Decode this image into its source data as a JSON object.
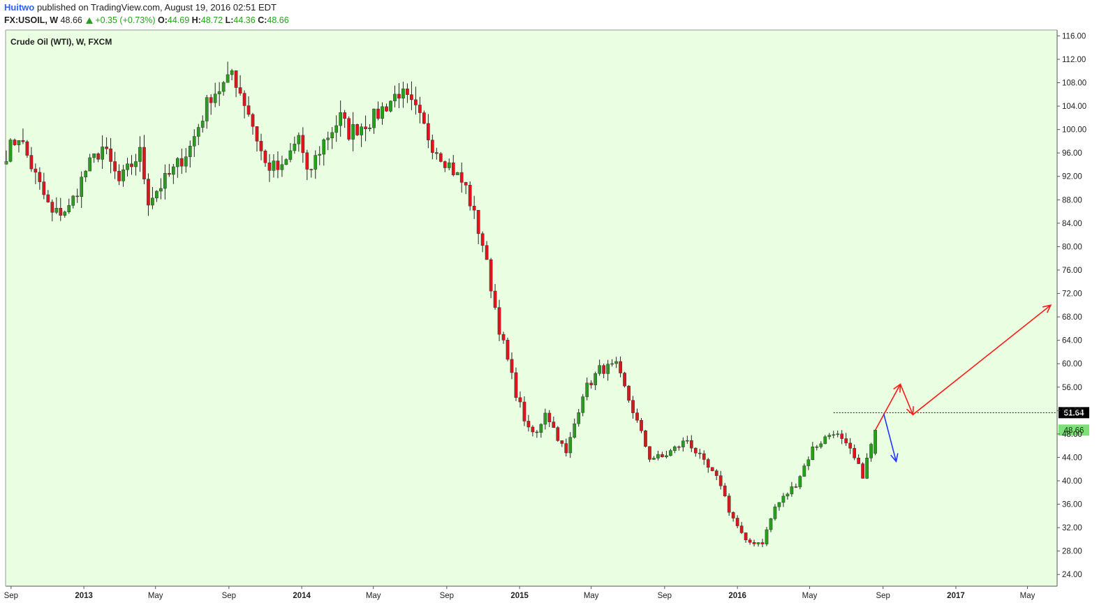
{
  "header": {
    "author": "Huitwo",
    "published": "published on TradingView.com, August 19, 2016 02:51 EDT",
    "symbol": "FX:USOIL, W",
    "last": "48.66",
    "change": "+0.35 (+0.73%)",
    "o_label": "O:",
    "o_value": "44.69",
    "h_label": "H:",
    "h_value": "48.72",
    "l_label": "L:",
    "l_value": "44.36",
    "c_label": "C:",
    "c_value": "48.66"
  },
  "colors": {
    "background": "#eaffe1",
    "up": "#26a01b",
    "down": "#e4121b",
    "arrow_red": "#ff1a1a",
    "arrow_blue": "#2233ff",
    "level_label_bg": "#000000",
    "price_label_bg": "#7fe07a"
  },
  "chart_data": {
    "type": "candlestick",
    "title": "Crude Oil (WTI), W, FXCM",
    "ylim": [
      22,
      117
    ],
    "y_ticks": [
      "24.00",
      "28.00",
      "32.00",
      "36.00",
      "40.00",
      "44.00",
      "48.00",
      "52.00",
      "56.00",
      "60.00",
      "64.00",
      "68.00",
      "72.00",
      "76.00",
      "80.00",
      "84.00",
      "88.00",
      "92.00",
      "96.00",
      "100.00",
      "104.00",
      "108.00",
      "112.00",
      "116.00"
    ],
    "x_labels": [
      {
        "label": "Sep",
        "date": "2012-09-01"
      },
      {
        "label": "2013",
        "date": "2013-01-01"
      },
      {
        "label": "May",
        "date": "2013-05-01"
      },
      {
        "label": "Sep",
        "date": "2013-09-01"
      },
      {
        "label": "2014",
        "date": "2014-01-01"
      },
      {
        "label": "May",
        "date": "2014-05-01"
      },
      {
        "label": "Sep",
        "date": "2014-09-01"
      },
      {
        "label": "2015",
        "date": "2015-01-01"
      },
      {
        "label": "May",
        "date": "2015-05-01"
      },
      {
        "label": "Sep",
        "date": "2015-09-01"
      },
      {
        "label": "2016",
        "date": "2016-01-01"
      },
      {
        "label": "May",
        "date": "2016-05-01"
      },
      {
        "label": "Sep",
        "date": "2016-09-01"
      },
      {
        "label": "2017",
        "date": "2017-01-01"
      },
      {
        "label": "May",
        "date": "2017-05-01"
      }
    ],
    "price_path": [
      [
        "2012-08-24",
        96.0
      ],
      [
        "2012-09-14",
        99.0
      ],
      [
        "2012-10-12",
        92.0
      ],
      [
        "2012-11-09",
        85.5
      ],
      [
        "2012-12-07",
        86.5
      ],
      [
        "2013-01-04",
        93.0
      ],
      [
        "2013-02-01",
        97.0
      ],
      [
        "2013-03-01",
        91.0
      ],
      [
        "2013-04-05",
        96.0
      ],
      [
        "2013-04-19",
        88.0
      ],
      [
        "2013-05-31",
        93.0
      ],
      [
        "2013-06-28",
        97.0
      ],
      [
        "2013-08-02",
        106.0
      ],
      [
        "2013-08-30",
        108.0
      ],
      [
        "2013-09-06",
        110.0
      ],
      [
        "2013-10-04",
        103.0
      ],
      [
        "2013-11-01",
        94.0
      ],
      [
        "2013-11-29",
        93.0
      ],
      [
        "2013-12-27",
        99.0
      ],
      [
        "2014-01-10",
        92.0
      ],
      [
        "2014-02-07",
        98.0
      ],
      [
        "2014-03-07",
        102.0
      ],
      [
        "2014-03-21",
        99.5
      ],
      [
        "2014-05-02",
        102.0
      ],
      [
        "2014-06-13",
        106.5
      ],
      [
        "2014-07-11",
        103.0
      ],
      [
        "2014-08-08",
        97.5
      ],
      [
        "2014-09-05",
        94.0
      ],
      [
        "2014-10-03",
        90.0
      ],
      [
        "2014-10-31",
        80.5
      ],
      [
        "2014-11-28",
        66.0
      ],
      [
        "2014-12-26",
        55.0
      ],
      [
        "2015-01-16",
        48.5
      ],
      [
        "2015-01-30",
        48.0
      ],
      [
        "2015-02-13",
        52.0
      ],
      [
        "2015-03-13",
        46.0
      ],
      [
        "2015-03-20",
        44.5
      ],
      [
        "2015-04-17",
        55.0
      ],
      [
        "2015-05-15",
        59.0
      ],
      [
        "2015-06-12",
        59.5
      ],
      [
        "2015-07-10",
        52.0
      ],
      [
        "2015-08-07",
        44.0
      ],
      [
        "2015-08-28",
        44.0
      ],
      [
        "2015-09-11",
        45.0
      ],
      [
        "2015-10-09",
        47.0
      ],
      [
        "2015-11-06",
        43.0
      ],
      [
        "2015-12-04",
        39.5
      ],
      [
        "2015-12-18",
        35.0
      ],
      [
        "2016-01-15",
        29.5
      ],
      [
        "2016-02-12",
        29.5
      ],
      [
        "2016-03-04",
        35.5
      ],
      [
        "2016-04-08",
        39.5
      ],
      [
        "2016-05-06",
        45.5
      ],
      [
        "2016-06-10",
        48.5
      ],
      [
        "2016-07-08",
        45.0
      ],
      [
        "2016-07-29",
        41.0
      ],
      [
        "2016-08-19",
        48.66
      ]
    ],
    "last_candle": {
      "date": "2016-08-19",
      "open": 44.69,
      "high": 48.72,
      "low": 44.36,
      "close": 48.66
    },
    "current_price": 48.66,
    "horizontal_level": 51.64,
    "annotations": [
      {
        "type": "path-arrow",
        "color": "red",
        "points": [
          [
            "2016-08-19",
            48.66
          ],
          [
            "2016-09-30",
            56.5
          ],
          [
            "2016-10-21",
            51.3
          ],
          [
            "2017-06-09",
            70.0
          ]
        ]
      },
      {
        "type": "path-arrow",
        "color": "blue",
        "points": [
          [
            "2016-09-02",
            51.5
          ],
          [
            "2016-09-23",
            43.3
          ]
        ]
      }
    ]
  }
}
